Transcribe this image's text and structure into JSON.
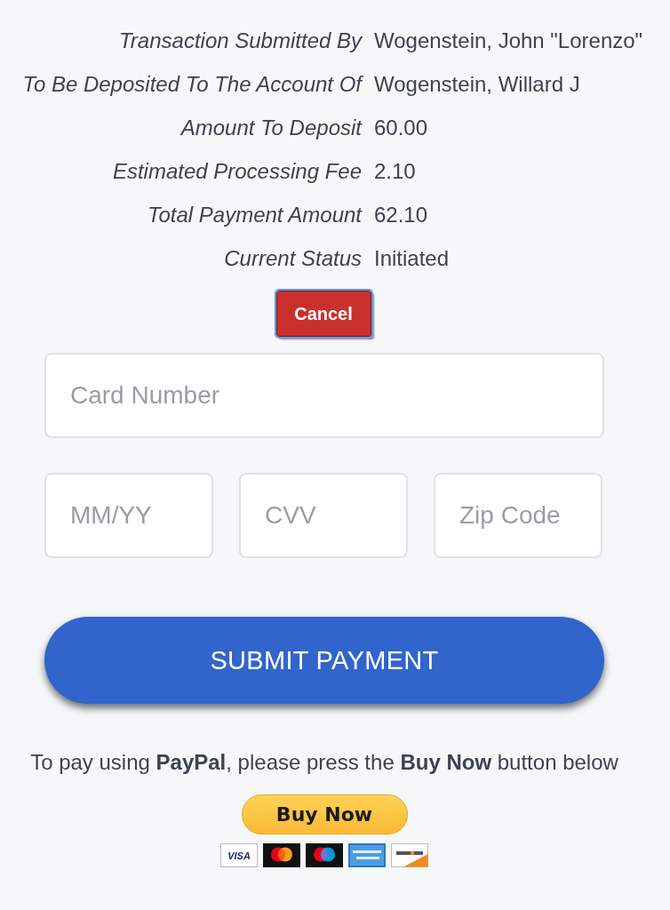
{
  "details": [
    {
      "label": "Transaction Submitted By",
      "value": "Wogenstein, John \"Lorenzo\""
    },
    {
      "label": "To Be Deposited To The Account Of",
      "value": "Wogenstein, Willard J"
    },
    {
      "label": "Amount To Deposit",
      "value": "60.00"
    },
    {
      "label": "Estimated Processing Fee",
      "value": "2.10"
    },
    {
      "label": "Total Payment Amount",
      "value": "62.10"
    },
    {
      "label": "Current Status",
      "value": "Initiated"
    }
  ],
  "cancel_button": {
    "label": "Cancel",
    "focused": true
  },
  "card_form": {
    "card_number": {
      "placeholder": "Card Number"
    },
    "fields": [
      {
        "placeholder": "MM/YY"
      },
      {
        "placeholder": "CVV"
      },
      {
        "placeholder": "Zip Code"
      }
    ]
  },
  "submit_button": {
    "label": "SUBMIT PAYMENT"
  },
  "paypal": {
    "note": "To pay using **PayPal**, please press the **Buy Now** button below",
    "button": {
      "label": "Buy Now"
    },
    "card_logos": [
      {
        "kind": "visa",
        "text": "VISA"
      },
      {
        "kind": "mastercard"
      },
      {
        "kind": "maestro"
      },
      {
        "kind": "amex"
      },
      {
        "kind": "discover"
      }
    ]
  }
}
